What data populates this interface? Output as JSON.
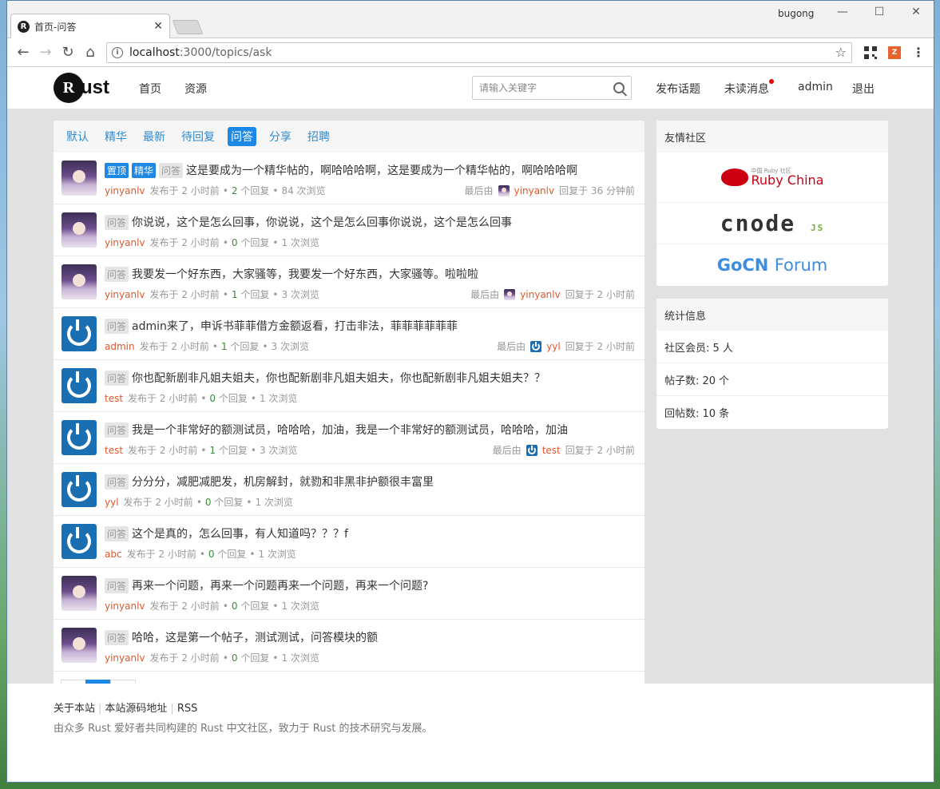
{
  "browser": {
    "user": "bugong",
    "tab_title": "首页-问答",
    "url_host": "localhost",
    "url_path": ":3000/topics/ask"
  },
  "header": {
    "logo_text": "ust",
    "nav": [
      "首页",
      "资源"
    ],
    "search_placeholder": "请输入关键字",
    "right_links": {
      "publish": "发布话题",
      "unread": "未读消息",
      "user": "admin",
      "logout": "退出"
    }
  },
  "tabs": [
    "默认",
    "精华",
    "最新",
    "待回复",
    "问答",
    "分享",
    "招聘"
  ],
  "active_tab": "问答",
  "topics": [
    {
      "avatar": "girl",
      "tags": [
        "置顶",
        "精华",
        "问答"
      ],
      "title": "这是要成为一个精华帖的，啊哈哈哈啊，这是要成为一个精华帖的，啊哈哈哈啊",
      "author": "yinyanlv",
      "posted": "发布于 2 小时前",
      "replies": "2",
      "reply_label": "个回复",
      "views": "84 次浏览",
      "last_label": "最后由",
      "last_avatar": "girl",
      "last_user": "yinyanlv",
      "last_time": "回复于 36 分钟前"
    },
    {
      "avatar": "girl",
      "tags": [
        "问答"
      ],
      "title": "你说说，这个是怎么回事，你说说，这个是怎么回事你说说，这个是怎么回事",
      "author": "yinyanlv",
      "posted": "发布于 2 小时前",
      "replies": "0",
      "reply_label": "个回复",
      "views": "1 次浏览"
    },
    {
      "avatar": "girl",
      "tags": [
        "问答"
      ],
      "title": "我要发一个好东西，大家骚等，我要发一个好东西，大家骚等。啦啦啦",
      "author": "yinyanlv",
      "posted": "发布于 2 小时前",
      "replies": "1",
      "reply_label": "个回复",
      "views": "3 次浏览",
      "last_label": "最后由",
      "last_avatar": "girl",
      "last_user": "yinyanlv",
      "last_time": "回复于 2 小时前"
    },
    {
      "avatar": "power",
      "tags": [
        "问答"
      ],
      "title": "admin来了，申诉书菲菲借方金额返看，打击非法，菲菲菲菲菲菲",
      "author": "admin",
      "posted": "发布于 2 小时前",
      "replies": "1",
      "reply_label": "个回复",
      "views": "3 次浏览",
      "last_label": "最后由",
      "last_avatar": "power",
      "last_user": "yyl",
      "last_time": "回复于 2 小时前"
    },
    {
      "avatar": "power",
      "tags": [
        "问答"
      ],
      "title": "你也配新剧非凡姐夫姐夫，你也配新剧非凡姐夫姐夫，你也配新剧非凡姐夫姐夫？？",
      "author": "test",
      "posted": "发布于 2 小时前",
      "replies": "0",
      "reply_label": "个回复",
      "views": "1 次浏览"
    },
    {
      "avatar": "power",
      "tags": [
        "问答"
      ],
      "title": "我是一个非常好的额测试员，哈哈哈，加油，我是一个非常好的额测试员，哈哈哈，加油",
      "author": "test",
      "posted": "发布于 2 小时前",
      "replies": "1",
      "reply_label": "个回复",
      "views": "3 次浏览",
      "last_label": "最后由",
      "last_avatar": "power",
      "last_user": "test",
      "last_time": "回复于 2 小时前"
    },
    {
      "avatar": "power",
      "tags": [
        "问答"
      ],
      "title": "分分分，减肥减肥发，机房解封，就勠和非黑非护额很丰富里",
      "author": "yyl",
      "posted": "发布于 2 小时前",
      "replies": "0",
      "reply_label": "个回复",
      "views": "1 次浏览"
    },
    {
      "avatar": "power",
      "tags": [
        "问答"
      ],
      "title": "这个是真的，怎么回事，有人知道吗？？？f",
      "author": "abc",
      "posted": "发布于 2 小时前",
      "replies": "0",
      "reply_label": "个回复",
      "views": "1 次浏览"
    },
    {
      "avatar": "girl",
      "tags": [
        "问答"
      ],
      "title": "再来一个问题，再来一个问题再来一个问题，再来一个问题?",
      "author": "yinyanlv",
      "posted": "发布于 2 小时前",
      "replies": "0",
      "reply_label": "个回复",
      "views": "1 次浏览"
    },
    {
      "avatar": "girl",
      "tags": [
        "问答"
      ],
      "title": "哈哈，这是第一个帖子，测试测试，问答模块的额",
      "author": "yinyanlv",
      "posted": "发布于 2 小时前",
      "replies": "0",
      "reply_label": "个回复",
      "views": "1 次浏览"
    }
  ],
  "pagination": {
    "prev": "«",
    "current": "1",
    "next": "»"
  },
  "sidebar": {
    "friends_title": "友情社区",
    "friends": {
      "ruby_small": "中国 Ruby 社区",
      "ruby": "Ruby China",
      "cnode": "cnode",
      "cnode_js": "JS",
      "gocn_bold": "GoCN",
      "gocn_rest": "Forum"
    },
    "stats_title": "统计信息",
    "stats": [
      "社区会员: 5 人",
      "帖子数: 20 个",
      "回帖数: 10 条"
    ]
  },
  "footer": {
    "links": [
      "关于本站",
      "本站源码地址",
      "RSS"
    ],
    "description": "由众多 Rust 爱好者共同构建的 Rust 中文社区，致力于 Rust 的技术研究与发展。"
  },
  "colors": {
    "accent": "#1e88e5",
    "author": "#e0582b",
    "unread_dot": "#ee0000"
  }
}
